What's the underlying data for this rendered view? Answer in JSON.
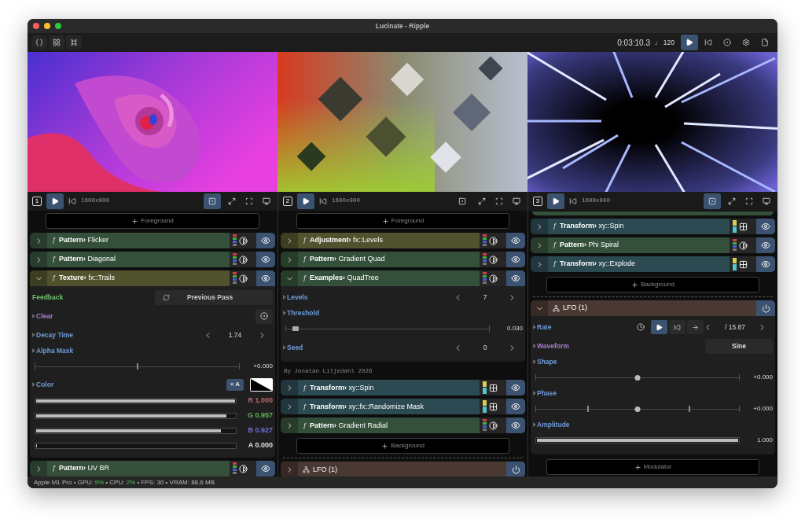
{
  "window": {
    "title": "Lucinate - Ripple"
  },
  "toolbar": {
    "time": "0:03:10.3",
    "tempo": "♩ 120",
    "play_selected": true
  },
  "columns": [
    {
      "number": "1",
      "play_selected": true,
      "resolution": "1600x900",
      "fit_selected": true,
      "items": [
        {
          "kind": "add",
          "label": "Foreground"
        },
        {
          "kind": "rgb_layer",
          "glyph": "ƒ",
          "category": "Pattern›",
          "name": "Flicker",
          "color": "#34503a",
          "expanded": false
        },
        {
          "kind": "rgb_layer",
          "glyph": "ƒ",
          "category": "Pattern›",
          "name": "Diagonal",
          "color": "#34503a",
          "expanded": false
        },
        {
          "kind": "rgb_layer",
          "glyph": "ƒ",
          "category": "Texture›",
          "name": "fx::Trails",
          "color": "#50532e",
          "expanded": true,
          "params": [
            {
              "kind": "button",
              "label": "Feedback",
              "color": "#6fbf6f",
              "disclosure": false,
              "value": "Previous Pass"
            },
            {
              "kind": "trigger",
              "label": "Clear",
              "color": "#a77fd0",
              "disclosure": true
            },
            {
              "kind": "stepper",
              "label": "Decay Time",
              "color": "#6f9bd6",
              "disclosure": true,
              "value": "1.74"
            },
            {
              "kind": "line_slider",
              "label": "Alpha Mask",
              "color": "#6f9bd6",
              "disclosure": true,
              "ticks": false,
              "level": 0.5,
              "reading": "+0.000"
            },
            {
              "kind": "color",
              "label": "Color",
              "color": "#6f9bd6",
              "disclosure": true,
              "button": "× A",
              "channels": [
                {
                  "reading": "R 1.000",
                  "level": 1,
                  "color": "#c46464"
                },
                {
                  "reading": "G 0.957",
                  "level": 0.957,
                  "color": "#5fb35f"
                },
                {
                  "reading": "B 0.927",
                  "level": 0.927,
                  "color": "#7070e0"
                },
                {
                  "reading": "A 0.000",
                  "level": 0,
                  "color": "#e0e0e0"
                }
              ]
            }
          ]
        },
        {
          "kind": "rgb_layer",
          "glyph": "ƒ",
          "category": "Pattern›",
          "name": "UV BR",
          "color": "#34503a",
          "expanded": false
        }
      ]
    },
    {
      "number": "2",
      "play_selected": true,
      "resolution": "1600x900",
      "fit_selected": false,
      "items": [
        {
          "kind": "add",
          "label": "Foreground"
        },
        {
          "kind": "rgb_layer",
          "glyph": "ƒ",
          "category": "Adjustment›",
          "name": "fx::Levels",
          "color": "#50532e",
          "expanded": false
        },
        {
          "kind": "rgb_layer",
          "glyph": "ƒ",
          "category": "Pattern›",
          "name": "Gradient Quad",
          "color": "#34503a",
          "expanded": false
        },
        {
          "kind": "rgb_layer",
          "glyph": "ƒ",
          "category": "Examples›",
          "name": "QuadTree",
          "color": "#34503a",
          "expanded": true,
          "params": [
            {
              "kind": "stepper",
              "label": "Levels",
              "color": "#6f9bd6",
              "disclosure": true,
              "value": "7"
            },
            {
              "kind": "square_slider",
              "label": "Threshold",
              "color": "#6f9bd6",
              "disclosure": true,
              "ticks": false,
              "level": 0.03,
              "reading": "0.030"
            },
            {
              "kind": "stepper",
              "label": "Seed",
              "color": "#6f9bd6",
              "disclosure": true,
              "value": "0"
            }
          ]
        },
        {
          "kind": "credit",
          "text": "By Jonatan Liljedahl 2026"
        },
        {
          "kind": "xy_layer",
          "glyph": "ƒ",
          "category": "Transform›",
          "name": "xy::Spin",
          "color": "#2c4a52",
          "expanded": false
        },
        {
          "kind": "xy_layer",
          "glyph": "ƒ",
          "category": "Transform›",
          "name": "xy::fx::Randomize Mask",
          "color": "#2c4a52",
          "expanded": false
        },
        {
          "kind": "rgb_layer",
          "glyph": "ƒ",
          "category": "Pattern›",
          "name": "Gradient Radial",
          "color": "#34503a",
          "expanded": false
        },
        {
          "kind": "add",
          "label": "Background"
        },
        {
          "kind": "divider"
        },
        {
          "kind": "modulator",
          "name": "LFO (1)",
          "color": "#4a3833",
          "expanded": false
        }
      ]
    },
    {
      "number": "3",
      "play_selected": true,
      "resolution": "1600x900",
      "fit_selected": true,
      "items": [
        {
          "kind": "layer_edge",
          "color": "#34503a"
        },
        {
          "kind": "xy_layer",
          "glyph": "ƒ",
          "category": "Transform›",
          "name": "xy::Spin",
          "color": "#2c4a52",
          "expanded": false
        },
        {
          "kind": "rgb_layer",
          "glyph": "ƒ",
          "category": "Pattern›",
          "name": "Phi Spiral",
          "color": "#34503a",
          "expanded": false
        },
        {
          "kind": "xy_layer",
          "glyph": "ƒ",
          "category": "Transform›",
          "name": "xy::Explode",
          "color": "#2c4a52",
          "expanded": false
        },
        {
          "kind": "add",
          "label": "Background"
        },
        {
          "kind": "divider"
        },
        {
          "kind": "modulator",
          "name": "LFO (1)",
          "color": "#4a3833",
          "expanded": true,
          "params": [
            {
              "kind": "rate",
              "label": "Rate",
              "color": "#6f9bd6",
              "disclosure": true,
              "play_selected": true,
              "value": "/ 15.87"
            },
            {
              "kind": "select",
              "label": "Waveform",
              "color": "#a77fd0",
              "disclosure": true,
              "value": "Sine"
            },
            {
              "kind": "dot_slider",
              "label": "Shape",
              "color": "#6f9bd6",
              "disclosure": true,
              "ticks": false,
              "level": 0.5,
              "reading": "+0.000"
            },
            {
              "kind": "dot_slider",
              "label": "Phase",
              "color": "#6f9bd6",
              "disclosure": true,
              "ticks": true,
              "level": 0.5,
              "reading": "+0.000"
            },
            {
              "kind": "fill_slider",
              "label": "Amplitude",
              "color": "#6f9bd6",
              "disclosure": true,
              "ticks": false,
              "level": 1,
              "reading": "1.000"
            }
          ]
        },
        {
          "kind": "add",
          "label": "Modulator"
        }
      ]
    }
  ],
  "status_bar": {
    "segments": [
      {
        "text": "Apple M1 Pro • GPU: ",
        "accent": false
      },
      {
        "text": "9%",
        "accent": true
      },
      {
        "text": " • CPU: ",
        "accent": false
      },
      {
        "text": "2%",
        "accent": true
      },
      {
        "text": " • FPS: 30 • VRAM: 88,6 MB",
        "accent": false
      }
    ]
  }
}
